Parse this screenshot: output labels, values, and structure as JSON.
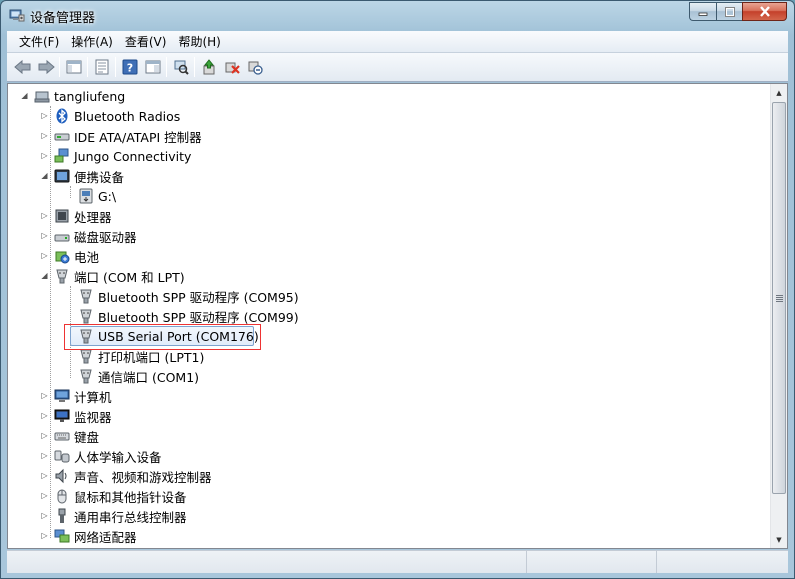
{
  "window": {
    "title": "设备管理器",
    "caption_buttons": [
      "minimize",
      "maximize",
      "close"
    ]
  },
  "menu": [
    {
      "label": "文件(F)"
    },
    {
      "label": "操作(A)"
    },
    {
      "label": "查看(V)"
    },
    {
      "label": "帮助(H)"
    }
  ],
  "toolbar": [
    {
      "icon": "back-arrow-icon"
    },
    {
      "icon": "forward-arrow-icon"
    },
    {
      "icon": "sep"
    },
    {
      "icon": "show-hide-tree-icon"
    },
    {
      "icon": "sep"
    },
    {
      "icon": "properties-icon"
    },
    {
      "icon": "sep"
    },
    {
      "icon": "help-icon"
    },
    {
      "icon": "console-view-icon"
    },
    {
      "icon": "sep"
    },
    {
      "icon": "scan-hardware-icon"
    },
    {
      "icon": "sep"
    },
    {
      "icon": "update-driver-icon"
    },
    {
      "icon": "uninstall-icon"
    },
    {
      "icon": "disable-device-icon"
    }
  ],
  "tree": {
    "root": {
      "label": "tangliufeng",
      "icon": "computer-icon"
    },
    "items": [
      {
        "label": "Bluetooth Radios",
        "icon": "bluetooth-icon",
        "level": 1,
        "state": "collapsed"
      },
      {
        "label": "IDE ATA/ATAPI 控制器",
        "icon": "ide-controller-icon",
        "level": 1,
        "state": "collapsed"
      },
      {
        "label": "Jungo Connectivity",
        "icon": "network-device-icon",
        "level": 1,
        "state": "collapsed"
      },
      {
        "label": "便携设备",
        "icon": "portable-device-icon",
        "level": 1,
        "state": "expanded"
      },
      {
        "label": "G:\\",
        "icon": "portable-device-icon",
        "level": 2,
        "state": "leaf"
      },
      {
        "label": "处理器",
        "icon": "processor-icon",
        "level": 1,
        "state": "collapsed"
      },
      {
        "label": "磁盘驱动器",
        "icon": "disk-drive-icon",
        "level": 1,
        "state": "collapsed"
      },
      {
        "label": "电池",
        "icon": "battery-icon",
        "level": 1,
        "state": "collapsed"
      },
      {
        "label": "端口 (COM 和 LPT)",
        "icon": "port-icon",
        "level": 1,
        "state": "expanded"
      },
      {
        "label": "Bluetooth SPP 驱动程序 (COM95)",
        "icon": "port-icon",
        "level": 2,
        "state": "leaf"
      },
      {
        "label": "Bluetooth SPP 驱动程序 (COM99)",
        "icon": "port-icon",
        "level": 2,
        "state": "leaf"
      },
      {
        "label": "USB Serial Port (COM176)",
        "icon": "port-icon",
        "level": 2,
        "state": "leaf",
        "selected": true
      },
      {
        "label": "打印机端口 (LPT1)",
        "icon": "port-icon",
        "level": 2,
        "state": "leaf"
      },
      {
        "label": "通信端口 (COM1)",
        "icon": "port-icon",
        "level": 2,
        "state": "leaf"
      },
      {
        "label": "计算机",
        "icon": "computer-monitor-icon",
        "level": 1,
        "state": "collapsed"
      },
      {
        "label": "监视器",
        "icon": "monitor-icon",
        "level": 1,
        "state": "collapsed"
      },
      {
        "label": "键盘",
        "icon": "keyboard-icon",
        "level": 1,
        "state": "collapsed"
      },
      {
        "label": "人体学输入设备",
        "icon": "hid-icon",
        "level": 1,
        "state": "collapsed"
      },
      {
        "label": "声音、视频和游戏控制器",
        "icon": "speaker-icon",
        "level": 1,
        "state": "collapsed"
      },
      {
        "label": "鼠标和其他指针设备",
        "icon": "mouse-icon",
        "level": 1,
        "state": "collapsed"
      },
      {
        "label": "通用串行总线控制器",
        "icon": "usb-icon",
        "level": 1,
        "state": "collapsed"
      },
      {
        "label": "网络适配器",
        "icon": "network-adapter-icon",
        "level": 1,
        "state": "collapsed"
      }
    ]
  },
  "colors": {
    "selection_border": "#7da2ce",
    "highlight_box": "#ee3333",
    "window_frame": "#a8c6db"
  }
}
